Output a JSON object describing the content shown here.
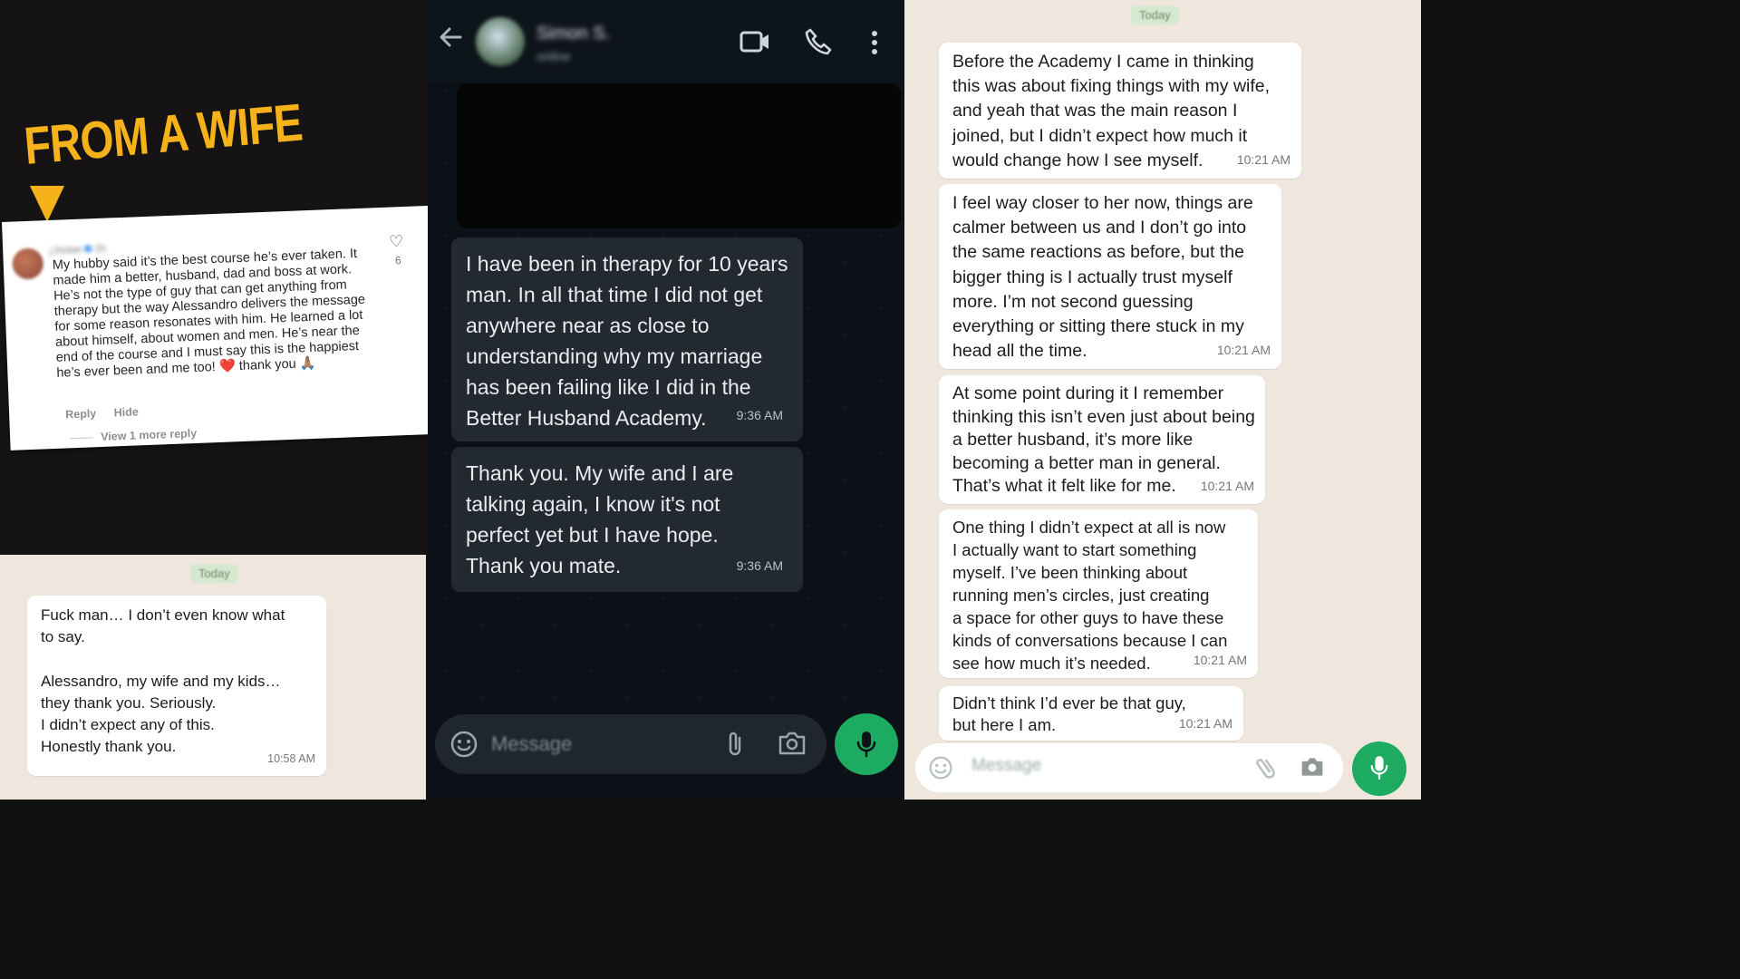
{
  "colors": {
    "accent": "#f6b21a",
    "whatsapp_green": "#1daa61",
    "dark_bubble": "#222a30",
    "light_bg": "#efe7de"
  },
  "left": {
    "headline": "FROM A WIFE",
    "comment": {
      "username": "j.fricker",
      "age": "2h",
      "text": "My hubby said it’s the best course he’s ever taken. It made him a better, husband, dad and boss at work. He’s not the type of guy that can get anything from therapy but the way Alessandro delivers the message for some reason resonates with him. He learned a lot about himself, about women and men. He’s near the end of the course and I must say this is the happiest he’s ever been and me too! ❤️ thank you 🙏🏽",
      "likes": "6",
      "reply": "Reply",
      "hide": "Hide",
      "view_more": "View 1 more reply"
    },
    "chat": {
      "date": "Today",
      "message": "Fuck man… I don’t even know what\nto say.\n\nAlessandro, my wife and my kids…\nthey thank you. Seriously.\nI didn’t expect any of this.\nHonestly thank you.",
      "time": "10:58 AM"
    }
  },
  "middle": {
    "contact_name": "Simon S.",
    "contact_status": "online",
    "messages": [
      {
        "text": "I have been in therapy for 10 years\nman. In all that time I did not get\nanywhere near as close to\nunderstanding why my marriage\nhas been failing like I did in the\nBetter Husband Academy.",
        "time": "9:36 AM"
      },
      {
        "text": "Thank you. My wife and I are\ntalking again, I know it's not\nperfect yet but I have hope.\nThank you mate.",
        "time": "9:36 AM"
      }
    ],
    "input_placeholder": "Message"
  },
  "right": {
    "date": "Today",
    "messages": [
      {
        "text": "Before the Academy I came in thinking\nthis was about fixing things with my wife,\nand yeah that was the main reason I\njoined, but I didn’t expect how much it\nwould change how I see myself.",
        "time": "10:21 AM"
      },
      {
        "text": "I feel way closer to her now, things are\ncalmer between us and I don’t go into\nthe same reactions as before, but the\nbigger thing is I actually trust myself\nmore. I’m not second guessing\neverything or sitting there stuck in my\nhead all the time.",
        "time": "10:21 AM"
      },
      {
        "text": "At some point during it I remember\nthinking this isn’t even just about being\na better husband, it’s more like\nbecoming a better man in general.\nThat’s what it felt like for me.",
        "time": "10:21 AM"
      },
      {
        "text": "One thing I didn’t expect at all is now\nI actually want to start something\nmyself. I’ve been thinking about\nrunning men’s circles, just creating\na space for other guys to have these\nkinds of conversations because I can\nsee how much it’s needed.",
        "time": "10:21 AM"
      },
      {
        "text": "Didn’t think I’d ever be that guy,\nbut here I am.",
        "time": "10:21 AM"
      }
    ],
    "input_placeholder": "Message"
  }
}
